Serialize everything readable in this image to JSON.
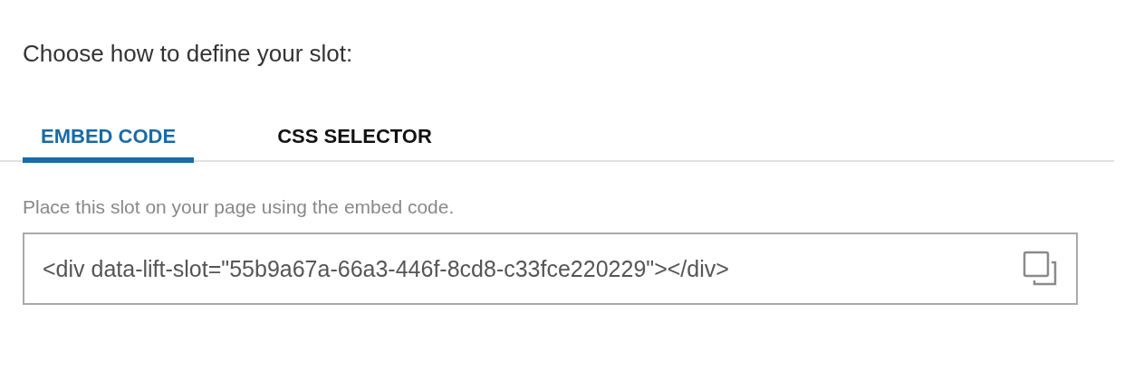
{
  "heading": "Choose how to define your slot:",
  "tabs": [
    {
      "label": "EMBED CODE",
      "selected": true
    },
    {
      "label": "CSS SELECTOR",
      "selected": false
    }
  ],
  "description": "Place this slot on your page using the embed code.",
  "embed_code": {
    "value": "<div data-lift-slot=\"55b9a67a-66a3-446f-8cd8-c33fce220229\"></div>"
  }
}
